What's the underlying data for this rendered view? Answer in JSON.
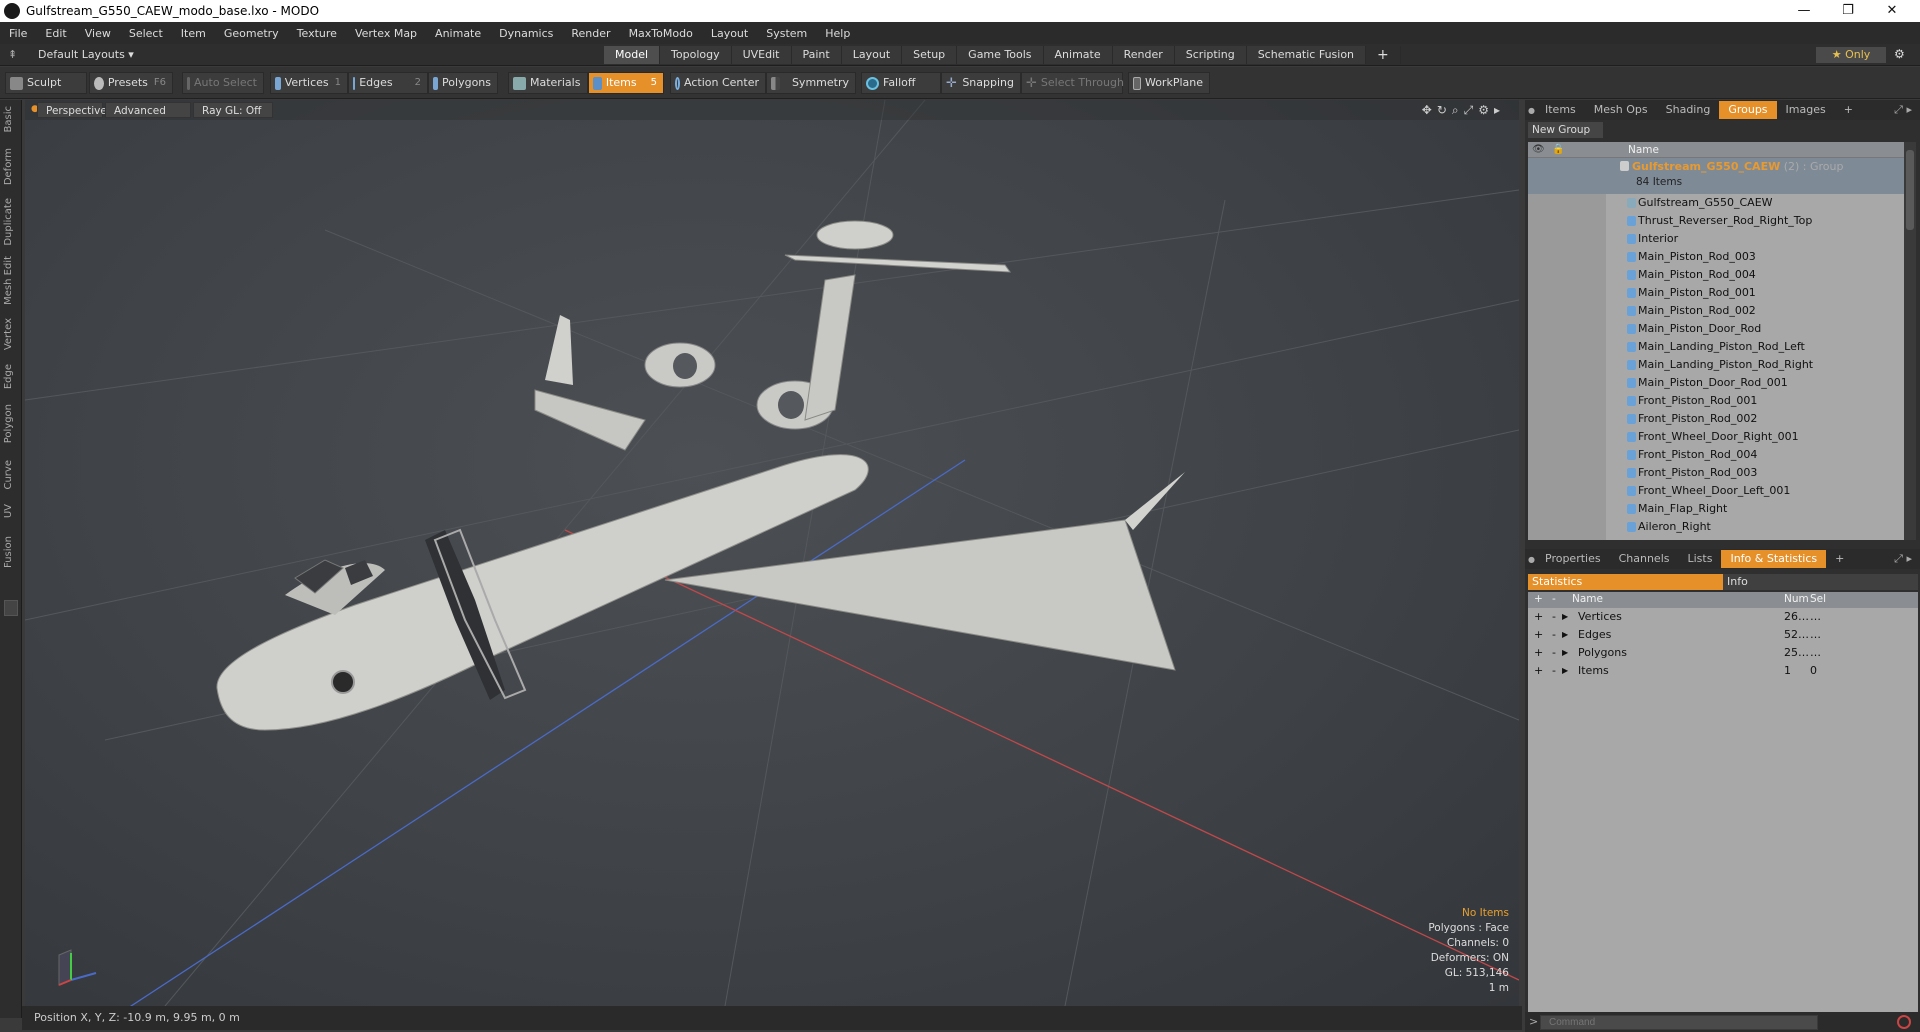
{
  "window": {
    "title": "Gulfstream_G550_CAEW_modo_base.lxo - MODO"
  },
  "menu": [
    "File",
    "Edit",
    "View",
    "Select",
    "Item",
    "Geometry",
    "Texture",
    "Vertex Map",
    "Animate",
    "Dynamics",
    "Render",
    "MaxToModo",
    "Layout",
    "System",
    "Help"
  ],
  "layout_bar": {
    "default_layouts": "Default Layouts ▾",
    "tabs": [
      "Model",
      "Topology",
      "UVEdit",
      "Paint",
      "Layout",
      "Setup",
      "Game Tools",
      "Animate",
      "Render",
      "Scripting",
      "Schematic Fusion"
    ],
    "active_tab": "Model",
    "only_label": "★  Only"
  },
  "toolbar": {
    "sculpt": "Sculpt",
    "presets": "Presets",
    "presets_key": "F6",
    "auto_select": "Auto Select",
    "vertices": "Vertices",
    "vertices_count": "1",
    "edges": "Edges",
    "edges_count": "2",
    "polygons": "Polygons",
    "materials": "Materials",
    "items": "Items",
    "items_count": "5",
    "action_center": "Action Center",
    "symmetry": "Symmetry",
    "falloff": "Falloff",
    "snapping": "Snapping",
    "select_through": "Select Through",
    "workplane": "WorkPlane"
  },
  "left_tabs": [
    "Basic",
    "Deform",
    "Duplicate",
    "Mesh Edit",
    "Vertex",
    "Edge",
    "Polygon",
    "Curve",
    "UV",
    "Fusion"
  ],
  "viewport": {
    "perspective": "Perspective",
    "advanced": "Advanced",
    "raygl": "Ray GL: Off",
    "hud": [
      "No Items",
      "Polygons : Face",
      "Channels: 0",
      "Deformers: ON",
      "GL: 513,146",
      "1 m"
    ]
  },
  "status": {
    "position": "Position X, Y, Z:   -10.9 m, 9.95 m, 0 m"
  },
  "items_panel": {
    "tabs": [
      "Items",
      "Mesh Ops",
      "Shading",
      "Groups",
      "Images",
      "+"
    ],
    "active_tab": "Groups",
    "new_group": "New Group",
    "name_header": "Name",
    "group": {
      "name": "Gulfstream_G550_CAEW",
      "tag": " (2) : Group",
      "count": "84 Items"
    },
    "items": [
      "Gulfstream_G550_CAEW",
      "Thrust_Reverser_Rod_Right_Top",
      "Interior",
      "Main_Piston_Rod_003",
      "Main_Piston_Rod_004",
      "Main_Piston_Rod_001",
      "Main_Piston_Rod_002",
      "Main_Piston_Door_Rod",
      "Main_Landing_Piston_Rod_Left",
      "Main_Landing_Piston_Rod_Right",
      "Main_Piston_Door_Rod_001",
      "Front_Piston_Rod_001",
      "Front_Piston_Rod_002",
      "Front_Wheel_Door_Right_001",
      "Front_Piston_Rod_004",
      "Front_Piston_Rod_003",
      "Front_Wheel_Door_Left_001",
      "Main_Flap_Right",
      "Aileron_Right"
    ]
  },
  "stats_panel": {
    "tabs": [
      "Properties",
      "Channels",
      "Lists",
      "Info & Statistics",
      "+"
    ],
    "active_tab": "Info & Statistics",
    "subtabs": [
      "Statistics",
      "Info"
    ],
    "headers": {
      "name": "Name",
      "num": "Num",
      "sel": "Sel"
    },
    "rows": [
      {
        "name": "Vertices",
        "num": "26…",
        "sel": "…"
      },
      {
        "name": "Edges",
        "num": "52…",
        "sel": "…"
      },
      {
        "name": "Polygons",
        "num": "25…",
        "sel": "…"
      },
      {
        "name": "Items",
        "num": "1",
        "sel": "0"
      }
    ]
  },
  "command": {
    "placeholder": "Command"
  },
  "colors": {
    "accent": "#e6902a",
    "group_name": "#e89a30",
    "panel_bg": "#a8a8a8"
  }
}
